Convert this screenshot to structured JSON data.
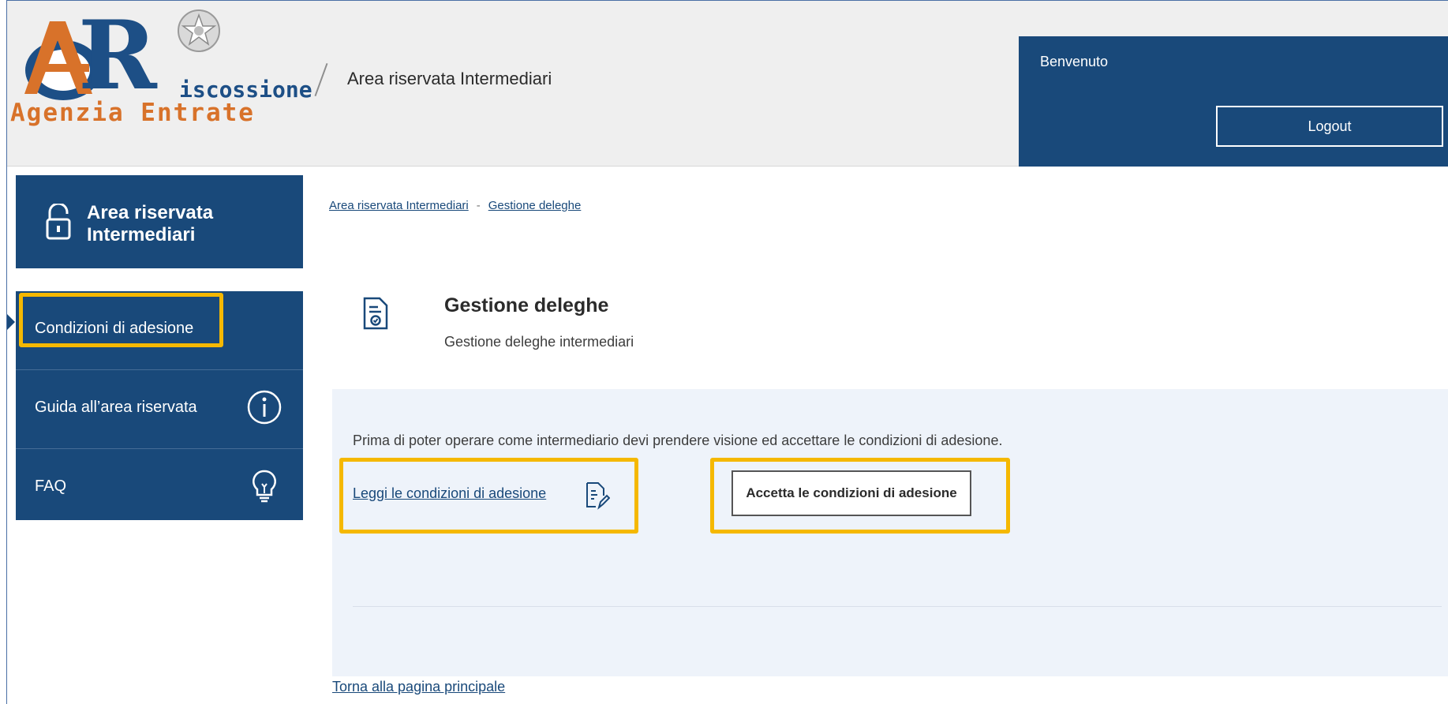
{
  "header": {
    "logo": {
      "top_line": "iscossione",
      "bottom_line": "Agenzia Entrate",
      "letter": "R"
    },
    "title": "Area riservata Intermediari",
    "welcome_label": "Benvenuto",
    "logout_label": "Logout"
  },
  "sidebar": {
    "title": "Area riservata Intermediari",
    "items": [
      {
        "label": "Condizioni di adesione",
        "icon": ""
      },
      {
        "label": "Guida all’area riservata",
        "icon": "info-icon"
      },
      {
        "label": "FAQ",
        "icon": "lightbulb-icon"
      }
    ]
  },
  "breadcrumb": {
    "items": [
      "Area riservata Intermediari",
      "Gestione deleghe"
    ],
    "separator": "-"
  },
  "card": {
    "title": "Gestione deleghe",
    "subtitle": "Gestione deleghe intermediari"
  },
  "panel": {
    "message": "Prima di poter operare come intermediario devi prendere visione ed accettare le condizioni di adesione.",
    "read_link": "Leggi le condizioni di adesione",
    "accept_button": "Accetta le condizioni di adesione"
  },
  "footer": {
    "back_link": "Torna alla pagina principale"
  },
  "colors": {
    "primary": "#19497a",
    "highlight": "#f5b800",
    "panel_bg": "#eef3fa",
    "header_bg": "#efefef",
    "logo_orange": "#d8722a"
  }
}
